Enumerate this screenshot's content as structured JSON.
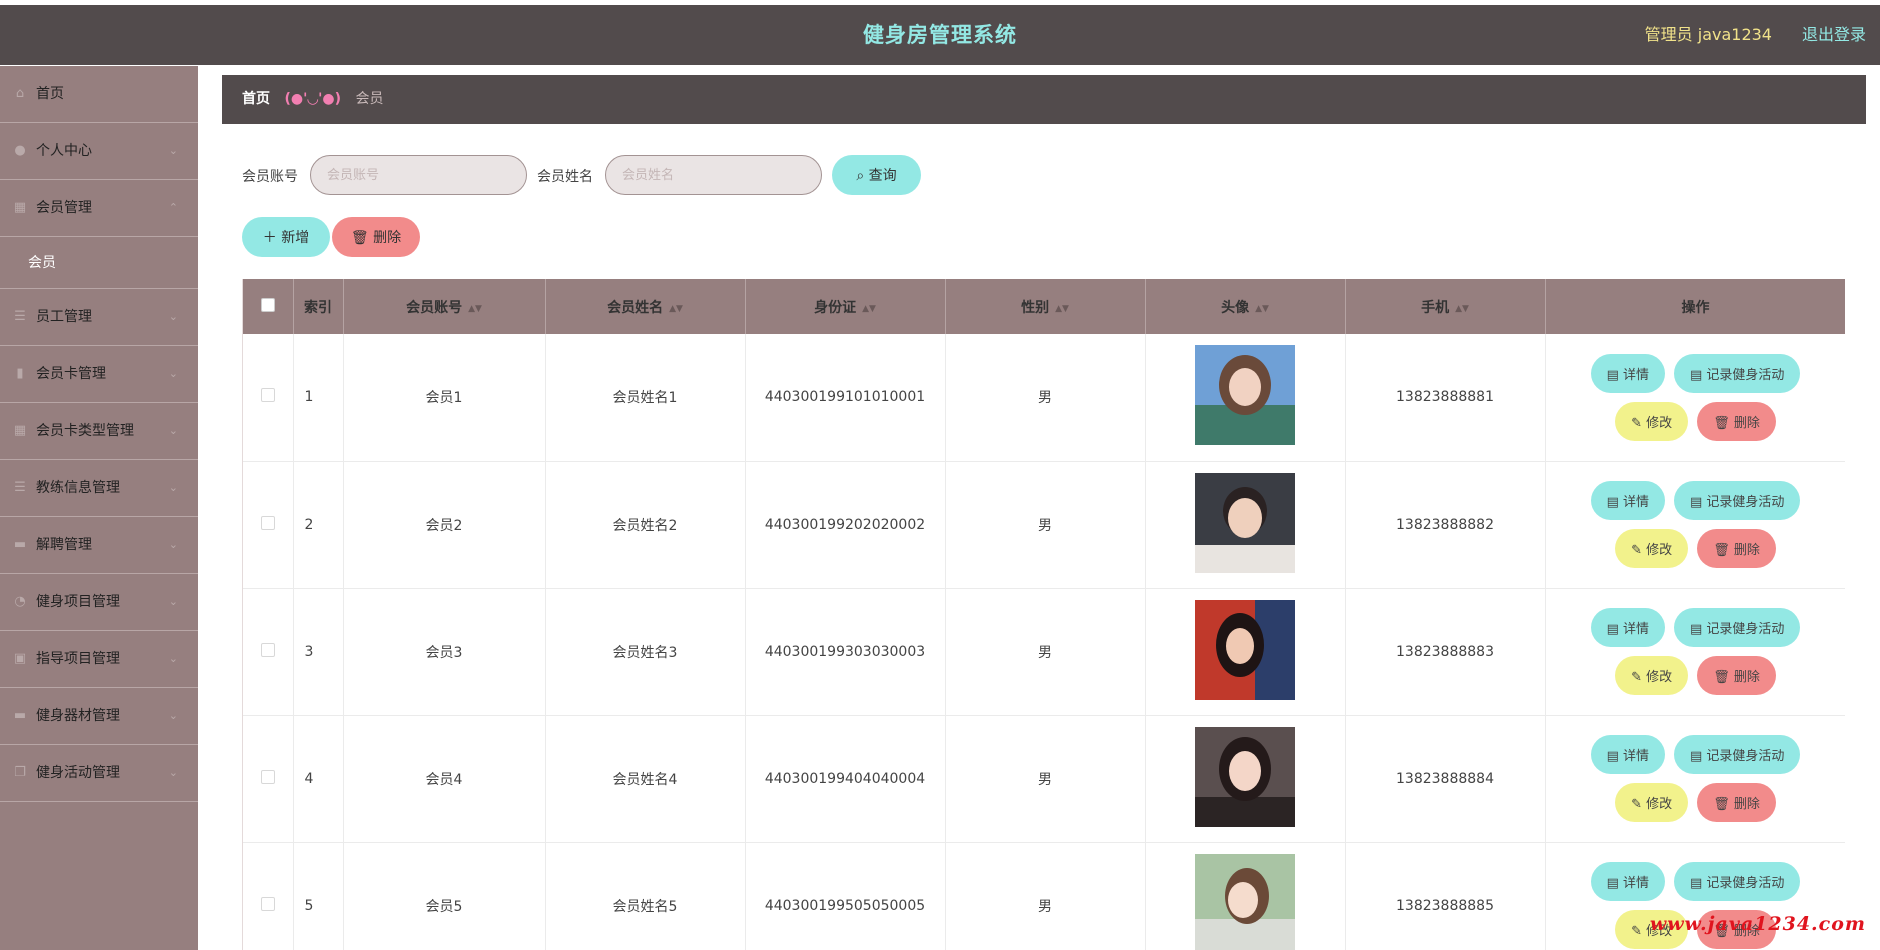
{
  "header": {
    "title": "健身房管理系统",
    "admin_label": "管理员 java1234",
    "logout_label": "退出登录"
  },
  "sidebar": {
    "items": [
      {
        "label": "首页",
        "icon": "home-icon"
      },
      {
        "label": "个人中心",
        "icon": "user-icon"
      },
      {
        "label": "会员管理",
        "icon": "grid-icon"
      },
      {
        "label": "员工管理",
        "icon": "list-icon"
      },
      {
        "label": "会员卡管理",
        "icon": "chart-icon"
      },
      {
        "label": "会员卡类型管理",
        "icon": "grid-icon"
      },
      {
        "label": "教练信息管理",
        "icon": "list-icon"
      },
      {
        "label": "解聘管理",
        "icon": "briefcase-icon"
      },
      {
        "label": "健身项目管理",
        "icon": "gauge-icon"
      },
      {
        "label": "指导项目管理",
        "icon": "image-icon"
      },
      {
        "label": "健身器材管理",
        "icon": "briefcase-icon"
      },
      {
        "label": "健身活动管理",
        "icon": "copy-icon"
      }
    ],
    "submenu": {
      "label": "会员"
    }
  },
  "breadcrumb": {
    "home": "首页",
    "separator": "(●'◡'●)",
    "current": "会员"
  },
  "search": {
    "account_label": "会员账号",
    "account_placeholder": "会员账号",
    "name_label": "会员姓名",
    "name_placeholder": "会员姓名",
    "query_label": "查询"
  },
  "toolbar": {
    "add_label": "新增",
    "delete_label": "删除"
  },
  "table": {
    "columns": [
      "索引",
      "会员账号",
      "会员姓名",
      "身份证",
      "性别",
      "头像",
      "手机",
      "操作"
    ],
    "rows": [
      {
        "index": "1",
        "account": "会员1",
        "name": "会员姓名1",
        "id_card": "440300199101010001",
        "gender": "男",
        "phone": "13823888881"
      },
      {
        "index": "2",
        "account": "会员2",
        "name": "会员姓名2",
        "id_card": "440300199202020002",
        "gender": "男",
        "phone": "13823888882"
      },
      {
        "index": "3",
        "account": "会员3",
        "name": "会员姓名3",
        "id_card": "440300199303030003",
        "gender": "男",
        "phone": "13823888883"
      },
      {
        "index": "4",
        "account": "会员4",
        "name": "会员姓名4",
        "id_card": "440300199404040004",
        "gender": "男",
        "phone": "13823888884"
      },
      {
        "index": "5",
        "account": "会员5",
        "name": "会员姓名5",
        "id_card": "440300199505050005",
        "gender": "男",
        "phone": "13823888885"
      }
    ],
    "actions": {
      "detail": "详情",
      "record": "记录健身活动",
      "edit": "修改",
      "delete": "删除"
    }
  },
  "watermark": "www.java1234.com",
  "colors": {
    "header_bg": "#524b4c",
    "title": "#93e8e4",
    "admin": "#f1e28a",
    "sidebar_bg": "#967f7f",
    "accent_cyan": "#93e8e4",
    "accent_red": "#f28b8b",
    "accent_yellow": "#f2f28c",
    "separator_pink": "#f27fb1"
  }
}
